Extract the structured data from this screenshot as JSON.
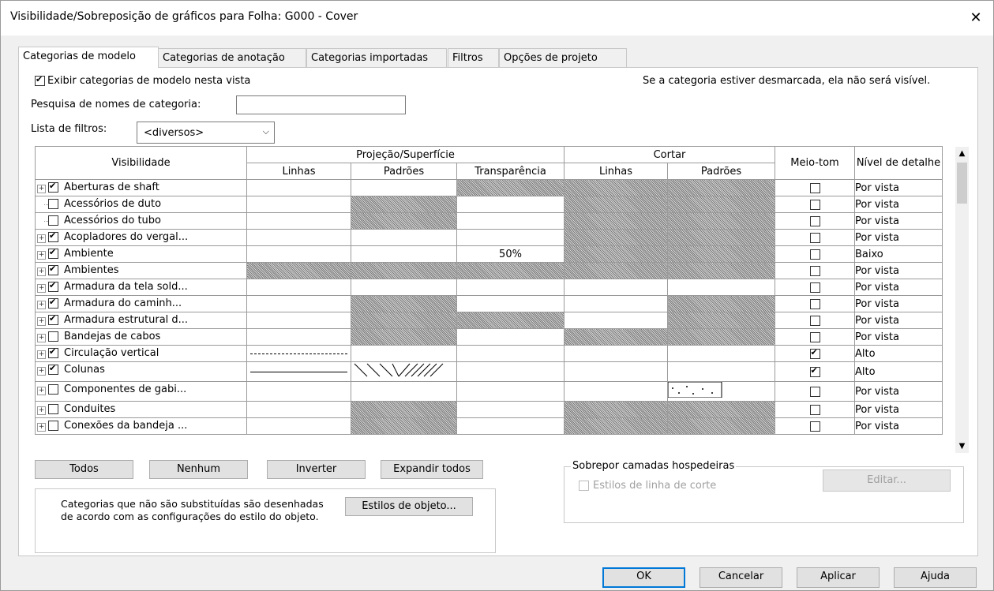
{
  "window": {
    "title": "Visibilidade/Sobreposição de gráficos para Folha: G000 - Cover"
  },
  "tabs": [
    "Categorias de modelo",
    "Categorias de anotação",
    "Categorias importadas",
    "Filtros",
    "Opções de projeto"
  ],
  "show_categories": {
    "label": "Exibir categorias de modelo nesta vista",
    "checked": true
  },
  "hint": "Se a categoria estiver desmarcada, ela não será visível.",
  "search": {
    "label": "Pesquisa de nomes de categoria:",
    "value": ""
  },
  "filter": {
    "label": "Lista de filtros:",
    "value": "<diversos>"
  },
  "table": {
    "col_visibility": "Visibilidade",
    "group_projection": "Projeção/Superfície",
    "group_cut": "Cortar",
    "col_lines": "Linhas",
    "col_patterns": "Padrões",
    "col_transparency": "Transparência",
    "col_cut_lines": "Linhas",
    "col_cut_patterns": "Padrões",
    "col_halftone": "Meio-tom",
    "col_detail": "Nível de detalhe",
    "rows": [
      {
        "name": "Aberturas de shaft",
        "checked": true,
        "expand": true,
        "detail": "Por vista"
      },
      {
        "name": "Acessórios de duto",
        "checked": false,
        "expand": false,
        "detail": "Por vista"
      },
      {
        "name": "Acessórios do tubo",
        "checked": false,
        "expand": false,
        "detail": "Por vista"
      },
      {
        "name": "Acopladores do vergal...",
        "checked": true,
        "expand": true,
        "detail": "Por vista"
      },
      {
        "name": "Ambiente",
        "checked": true,
        "expand": true,
        "detail": "Baixo",
        "transparency": "50%"
      },
      {
        "name": "Ambientes",
        "checked": true,
        "expand": true,
        "detail": "Por vista"
      },
      {
        "name": "Armadura da tela sold...",
        "checked": true,
        "expand": true,
        "detail": "Por vista"
      },
      {
        "name": "Armadura do caminh...",
        "checked": true,
        "expand": true,
        "detail": "Por vista"
      },
      {
        "name": "Armadura estrutural d...",
        "checked": true,
        "expand": true,
        "detail": "Por vista"
      },
      {
        "name": "Bandejas de cabos",
        "checked": false,
        "expand": true,
        "detail": "Por vista"
      },
      {
        "name": "Circulação vertical",
        "checked": true,
        "expand": true,
        "detail": "Alto",
        "halftone": true
      },
      {
        "name": "Colunas",
        "checked": true,
        "expand": true,
        "detail": "Alto",
        "halftone": true
      },
      {
        "name": "Componentes de gabi...",
        "checked": false,
        "expand": true,
        "detail": "Por vista"
      },
      {
        "name": "Conduites",
        "checked": false,
        "expand": true,
        "detail": "Por vista"
      },
      {
        "name": "Conexões da bandeja ...",
        "checked": false,
        "expand": true,
        "detail": "Por vista"
      }
    ]
  },
  "buttons": {
    "all": "Todos",
    "none": "Nenhum",
    "invert": "Inverter",
    "expand_all": "Expandir todos",
    "object_styles": "Estilos de objeto...",
    "edit": "Editar...",
    "ok": "OK",
    "cancel": "Cancelar",
    "apply": "Aplicar",
    "help": "Ajuda"
  },
  "info_text": "Categorias que não são substituídas são desenhadas de acordo com as configurações do estilo do objeto.",
  "host_layers": {
    "title": "Sobrepor camadas hospedeiras",
    "cut_line_styles": "Estilos de linha de corte"
  }
}
